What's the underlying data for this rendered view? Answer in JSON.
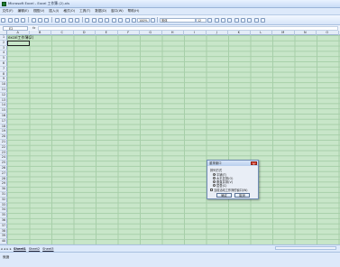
{
  "window": {
    "title": "Microsoft Excel - Excel 工作簿 (2).xls"
  },
  "menu": [
    "文件(F)",
    "编辑(E)",
    "视图(V)",
    "插入(I)",
    "格式(O)",
    "工具(T)",
    "数据(D)",
    "窗口(W)",
    "帮助(H)"
  ],
  "toolbar": {
    "zoom": "100%",
    "font_name": "宋体",
    "font_size": "12"
  },
  "formula": {
    "cell_ref": "E2",
    "fx_label": "fx"
  },
  "columns": [
    "A",
    "B",
    "C",
    "D",
    "E",
    "F",
    "G",
    "H",
    "I",
    "J",
    "K",
    "L",
    "M",
    "N",
    "O",
    "P"
  ],
  "rows": [
    "1",
    "2",
    "3",
    "4",
    "5",
    "6",
    "7",
    "8",
    "9",
    "10",
    "11",
    "12",
    "13",
    "14",
    "15",
    "16",
    "17",
    "18",
    "19",
    "20",
    "21",
    "22",
    "23",
    "24",
    "25",
    "26",
    "27",
    "28",
    "29",
    "30",
    "31",
    "32",
    "33",
    "34",
    "35",
    "36",
    "37",
    "38",
    "39",
    "40"
  ],
  "cells": {
    "A1": "excel工作薄(2)"
  },
  "sheets": [
    "Sheet1",
    "Sheet2",
    "Sheet3"
  ],
  "status": {
    "text": "就绪"
  },
  "dialog": {
    "title": "重排窗口",
    "group_label": "排列方式",
    "options": [
      "平铺(T)",
      "水平并排(O)",
      "垂直并排(V)",
      "层叠(C)"
    ],
    "selected_option": "平铺(T)",
    "checkbox_label": "当前活动工作簿的窗口(W)",
    "ok": "确定",
    "cancel": "取消",
    "close_glyph": "×"
  }
}
